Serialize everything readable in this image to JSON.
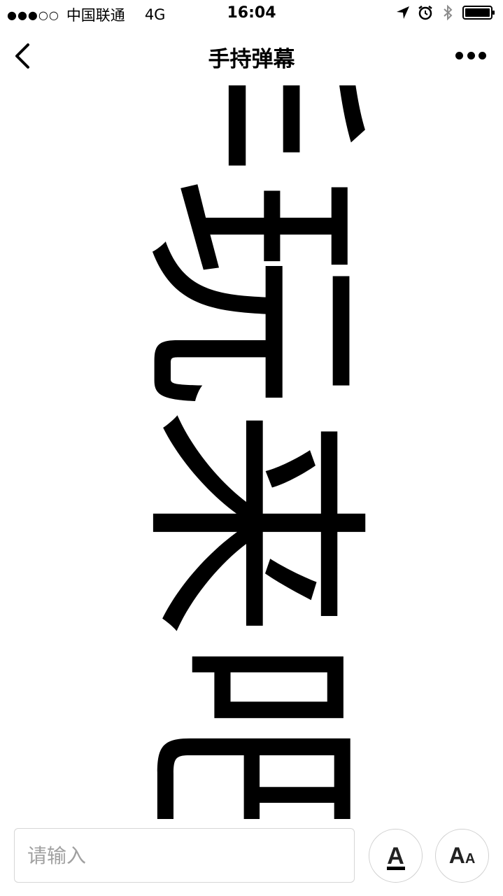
{
  "status_bar": {
    "signal": "●●●○○",
    "carrier": "中国联通",
    "network": "4G",
    "time": "16:04",
    "icons": [
      "location-arrow-icon",
      "alarm-icon",
      "bluetooth-icon",
      "battery-icon"
    ]
  },
  "nav": {
    "title": "手持弹幕",
    "back_icon": "chevron-left-icon",
    "more_icon": "more-dots-icon"
  },
  "danmaku": {
    "text": "手玩来吧"
  },
  "composer": {
    "placeholder": "请输入",
    "color_button_glyph": "A",
    "size_button_big": "A",
    "size_button_small": "A"
  },
  "colors": {
    "text": "#000000",
    "background": "#ffffff",
    "border": "#d6d6d6",
    "placeholder": "#9a9a9a"
  }
}
